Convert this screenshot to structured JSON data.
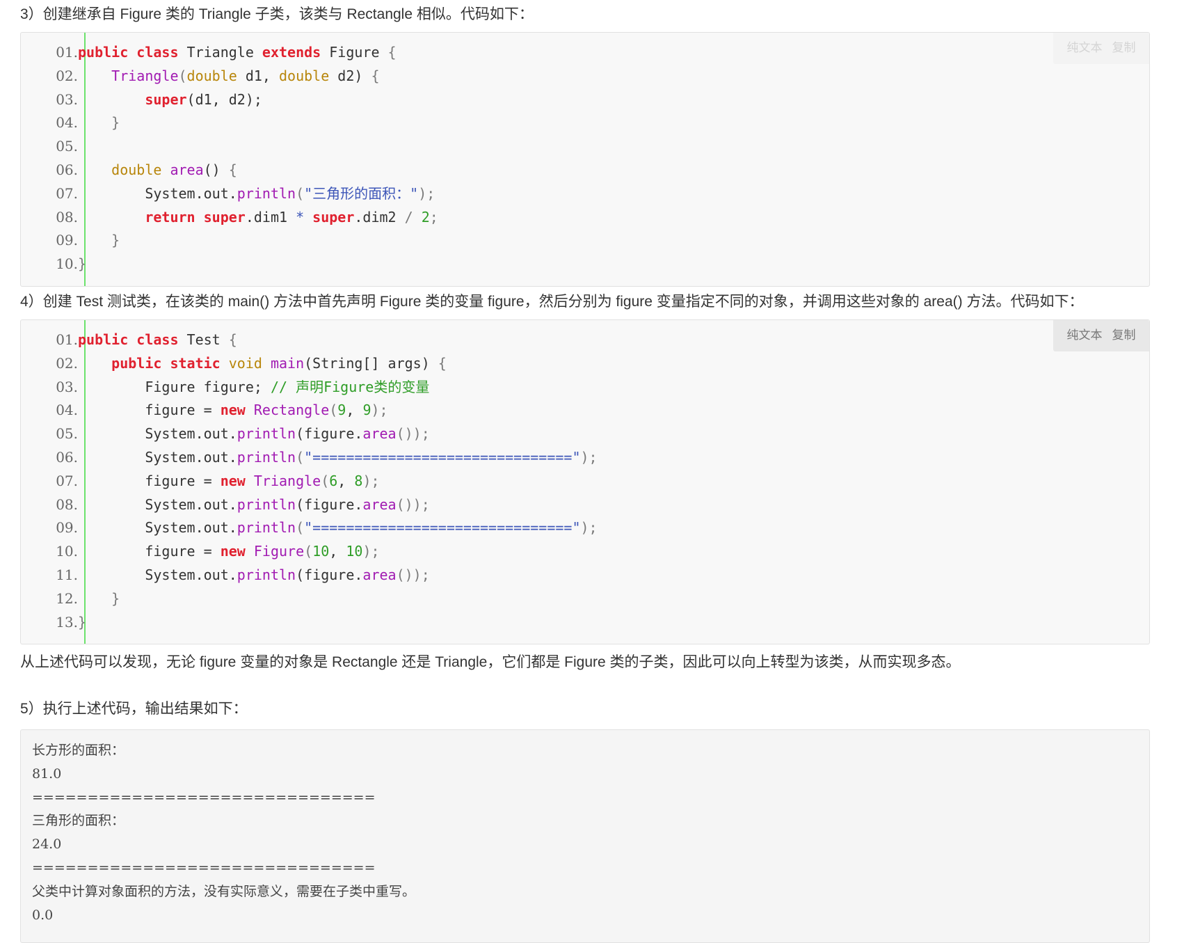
{
  "steps": {
    "step3": "3）创建继承自 Figure 类的 Triangle 子类，该类与 Rectangle 相似。代码如下：",
    "step4": "4）创建 Test 测试类，在该类的 main() 方法中首先声明 Figure 类的变量 figure，然后分别为 figure 变量指定不同的对象，并调用这些对象的 area() 方法。代码如下：",
    "conclusion": "从上述代码可以发现，无论 figure 变量的对象是 Rectangle 还是 Triangle，它们都是 Figure 类的子类，因此可以向上转型为该类，从而实现多态。",
    "step5": "5）执行上述代码，输出结果如下："
  },
  "toolbar": {
    "plain_text": "纯文本",
    "copy": "复制"
  },
  "code_block_1": {
    "lines": [
      {
        "num": "01.",
        "tokens": [
          {
            "t": "public class ",
            "k": "kw"
          },
          {
            "t": "Triangle ",
            "k": "plain"
          },
          {
            "t": "extends ",
            "k": "kw"
          },
          {
            "t": "Figure ",
            "k": "plain"
          },
          {
            "t": "{",
            "k": "punc"
          }
        ]
      },
      {
        "num": "02.",
        "tokens": [
          {
            "t": "    ",
            "k": "plain"
          },
          {
            "t": "Triangle",
            "k": "fn"
          },
          {
            "t": "(",
            "k": "punc"
          },
          {
            "t": "double",
            "k": "type"
          },
          {
            "t": " d1, ",
            "k": "plain"
          },
          {
            "t": "double",
            "k": "type"
          },
          {
            "t": " d2) ",
            "k": "plain"
          },
          {
            "t": "{",
            "k": "punc"
          }
        ]
      },
      {
        "num": "03.",
        "tokens": [
          {
            "t": "        ",
            "k": "plain"
          },
          {
            "t": "super",
            "k": "kw"
          },
          {
            "t": "(d1, d2);",
            "k": "plain"
          }
        ]
      },
      {
        "num": "04.",
        "tokens": [
          {
            "t": "    ",
            "k": "plain"
          },
          {
            "t": "}",
            "k": "punc"
          }
        ]
      },
      {
        "num": "05.",
        "tokens": []
      },
      {
        "num": "06.",
        "tokens": [
          {
            "t": "    ",
            "k": "plain"
          },
          {
            "t": "double",
            "k": "type"
          },
          {
            "t": " ",
            "k": "plain"
          },
          {
            "t": "area",
            "k": "fn"
          },
          {
            "t": "() ",
            "k": "plain"
          },
          {
            "t": "{",
            "k": "punc"
          }
        ]
      },
      {
        "num": "07.",
        "tokens": [
          {
            "t": "        System.out.",
            "k": "plain"
          },
          {
            "t": "println",
            "k": "fn"
          },
          {
            "t": "(",
            "k": "punc"
          },
          {
            "t": "\"三角形的面积：\"",
            "k": "str"
          },
          {
            "t": ");",
            "k": "punc"
          }
        ]
      },
      {
        "num": "08.",
        "tokens": [
          {
            "t": "        ",
            "k": "plain"
          },
          {
            "t": "return super",
            "k": "kw"
          },
          {
            "t": ".dim1 ",
            "k": "plain"
          },
          {
            "t": "*",
            "k": "str"
          },
          {
            "t": " ",
            "k": "plain"
          },
          {
            "t": "super",
            "k": "kw"
          },
          {
            "t": ".dim2 ",
            "k": "plain"
          },
          {
            "t": "/",
            "k": "punc"
          },
          {
            "t": " ",
            "k": "plain"
          },
          {
            "t": "2",
            "k": "num"
          },
          {
            "t": ";",
            "k": "punc"
          }
        ]
      },
      {
        "num": "09.",
        "tokens": [
          {
            "t": "    ",
            "k": "plain"
          },
          {
            "t": "}",
            "k": "punc"
          }
        ]
      },
      {
        "num": "10.",
        "tokens": [
          {
            "t": "}",
            "k": "punc"
          }
        ]
      }
    ]
  },
  "code_block_2": {
    "lines": [
      {
        "num": "01.",
        "tokens": [
          {
            "t": "public class ",
            "k": "kw"
          },
          {
            "t": "Test ",
            "k": "plain"
          },
          {
            "t": "{",
            "k": "punc"
          }
        ]
      },
      {
        "num": "02.",
        "tokens": [
          {
            "t": "    ",
            "k": "plain"
          },
          {
            "t": "public static ",
            "k": "kw"
          },
          {
            "t": "void",
            "k": "type"
          },
          {
            "t": " ",
            "k": "plain"
          },
          {
            "t": "main",
            "k": "fn"
          },
          {
            "t": "(String[] args) ",
            "k": "plain"
          },
          {
            "t": "{",
            "k": "punc"
          }
        ]
      },
      {
        "num": "03.",
        "tokens": [
          {
            "t": "        Figure figure; ",
            "k": "plain"
          },
          {
            "t": "// 声明Figure类的变量",
            "k": "cmt"
          }
        ]
      },
      {
        "num": "04.",
        "tokens": [
          {
            "t": "        figure = ",
            "k": "plain"
          },
          {
            "t": "new",
            "k": "kw"
          },
          {
            "t": " ",
            "k": "plain"
          },
          {
            "t": "Rectangle",
            "k": "fn"
          },
          {
            "t": "(",
            "k": "punc"
          },
          {
            "t": "9",
            "k": "num"
          },
          {
            "t": ", ",
            "k": "plain"
          },
          {
            "t": "9",
            "k": "num"
          },
          {
            "t": ");",
            "k": "punc"
          }
        ]
      },
      {
        "num": "05.",
        "tokens": [
          {
            "t": "        System.out.",
            "k": "plain"
          },
          {
            "t": "println",
            "k": "fn"
          },
          {
            "t": "(figure.",
            "k": "plain"
          },
          {
            "t": "area",
            "k": "fn"
          },
          {
            "t": "());",
            "k": "punc"
          }
        ]
      },
      {
        "num": "06.",
        "tokens": [
          {
            "t": "        System.out.",
            "k": "plain"
          },
          {
            "t": "println",
            "k": "fn"
          },
          {
            "t": "(",
            "k": "punc"
          },
          {
            "t": "\"===============================\"",
            "k": "str"
          },
          {
            "t": ");",
            "k": "punc"
          }
        ]
      },
      {
        "num": "07.",
        "tokens": [
          {
            "t": "        figure = ",
            "k": "plain"
          },
          {
            "t": "new",
            "k": "kw"
          },
          {
            "t": " ",
            "k": "plain"
          },
          {
            "t": "Triangle",
            "k": "fn"
          },
          {
            "t": "(",
            "k": "punc"
          },
          {
            "t": "6",
            "k": "num"
          },
          {
            "t": ", ",
            "k": "plain"
          },
          {
            "t": "8",
            "k": "num"
          },
          {
            "t": ");",
            "k": "punc"
          }
        ]
      },
      {
        "num": "08.",
        "tokens": [
          {
            "t": "        System.out.",
            "k": "plain"
          },
          {
            "t": "println",
            "k": "fn"
          },
          {
            "t": "(figure.",
            "k": "plain"
          },
          {
            "t": "area",
            "k": "fn"
          },
          {
            "t": "());",
            "k": "punc"
          }
        ]
      },
      {
        "num": "09.",
        "tokens": [
          {
            "t": "        System.out.",
            "k": "plain"
          },
          {
            "t": "println",
            "k": "fn"
          },
          {
            "t": "(",
            "k": "punc"
          },
          {
            "t": "\"===============================\"",
            "k": "str"
          },
          {
            "t": ");",
            "k": "punc"
          }
        ]
      },
      {
        "num": "10.",
        "tokens": [
          {
            "t": "        figure = ",
            "k": "plain"
          },
          {
            "t": "new",
            "k": "kw"
          },
          {
            "t": " ",
            "k": "plain"
          },
          {
            "t": "Figure",
            "k": "fn"
          },
          {
            "t": "(",
            "k": "punc"
          },
          {
            "t": "10",
            "k": "num"
          },
          {
            "t": ", ",
            "k": "plain"
          },
          {
            "t": "10",
            "k": "num"
          },
          {
            "t": ");",
            "k": "punc"
          }
        ]
      },
      {
        "num": "11.",
        "tokens": [
          {
            "t": "        System.out.",
            "k": "plain"
          },
          {
            "t": "println",
            "k": "fn"
          },
          {
            "t": "(figure.",
            "k": "plain"
          },
          {
            "t": "area",
            "k": "fn"
          },
          {
            "t": "());",
            "k": "punc"
          }
        ]
      },
      {
        "num": "12.",
        "tokens": [
          {
            "t": "    ",
            "k": "plain"
          },
          {
            "t": "}",
            "k": "punc"
          }
        ]
      },
      {
        "num": "13.",
        "tokens": [
          {
            "t": "}",
            "k": "punc"
          }
        ]
      }
    ]
  },
  "output": {
    "lines": [
      "长方形的面积：",
      "81.0",
      "===============================",
      "三角形的面积：",
      "24.0",
      "===============================",
      "父类中计算对象面积的方法，没有实际意义，需要在子类中重写。",
      "0.0"
    ]
  },
  "colors": {
    "keyword": "#e0212f",
    "type": "#b8860b",
    "function": "#a11bb2",
    "number": "#2f9d27",
    "string": "#3d56b8",
    "gutter_border": "#6ce26c"
  }
}
